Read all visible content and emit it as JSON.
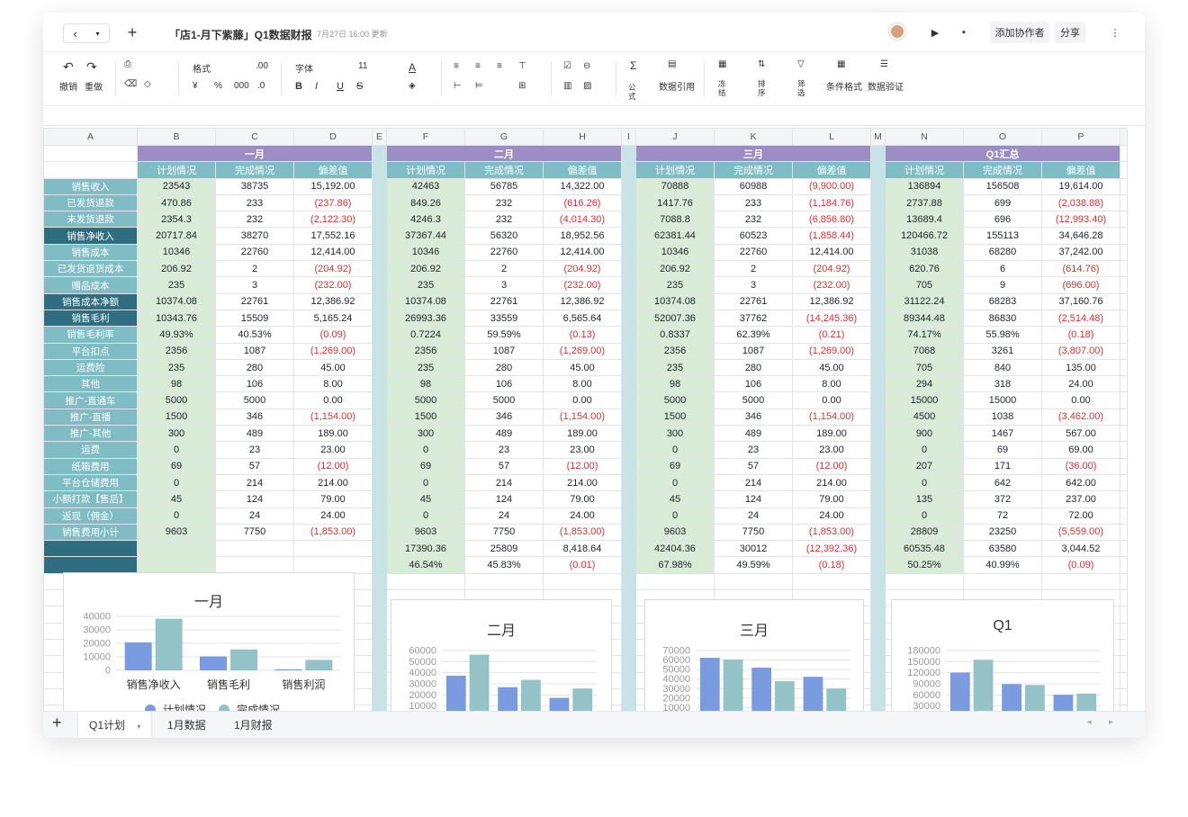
{
  "title": "「店1-月下紫藤」Q1数据财报",
  "updated": "7月27日 16:00 更新",
  "header_buttons": {
    "collab": "添加协作者",
    "share": "分享"
  },
  "ribbon": {
    "undo": "撤销",
    "redo": "重做",
    "format": "格式",
    "decimal": ".00",
    "font": "字体",
    "size": "11",
    "currency": "¥",
    "percent": "%",
    "thousands": "000",
    "decimal2": ".0",
    "formula": "公式",
    "dataref": "数据引用",
    "freeze": "冻结",
    "sort": "排序",
    "filter": "筛选",
    "cond": "条件格式",
    "validate": "数据验证"
  },
  "columns": [
    "A",
    "B",
    "C",
    "D",
    "E",
    "F",
    "G",
    "H",
    "I",
    "J",
    "K",
    "L",
    "M",
    "N",
    "O",
    "P"
  ],
  "months": [
    "一月",
    "二月",
    "三月",
    "Q1汇总"
  ],
  "subheaders": [
    "计划情况",
    "完成情况",
    "偏差值"
  ],
  "rows": [
    {
      "label": "销售收入",
      "dark": false,
      "v": [
        [
          "23543",
          "38735",
          "15,192.00"
        ],
        [
          "42463",
          "56785",
          "14,322.00"
        ],
        [
          "70888",
          "60988",
          "(9,900.00)"
        ],
        [
          "136894",
          "156508",
          "19,614.00"
        ]
      ]
    },
    {
      "label": "已发货退款",
      "dark": false,
      "v": [
        [
          "470.86",
          "233",
          "(237.86)"
        ],
        [
          "849.26",
          "232",
          "(616.26)"
        ],
        [
          "1417.76",
          "233",
          "(1,184.76)"
        ],
        [
          "2737.88",
          "699",
          "(2,038.88)"
        ]
      ]
    },
    {
      "label": "未发货退款",
      "dark": false,
      "v": [
        [
          "2354.3",
          "232",
          "(2,122.30)"
        ],
        [
          "4246.3",
          "232",
          "(4,014.30)"
        ],
        [
          "7088.8",
          "232",
          "(6,856.80)"
        ],
        [
          "13689.4",
          "696",
          "(12,993.40)"
        ]
      ]
    },
    {
      "label": "销售净收入",
      "dark": true,
      "v": [
        [
          "20717.84",
          "38270",
          "17,552.16"
        ],
        [
          "37367.44",
          "56320",
          "18,952.56"
        ],
        [
          "62381.44",
          "60523",
          "(1,858.44)"
        ],
        [
          "120466.72",
          "155113",
          "34,646.28"
        ]
      ]
    },
    {
      "label": "销售成本",
      "dark": false,
      "v": [
        [
          "10346",
          "22760",
          "12,414.00"
        ],
        [
          "10346",
          "22760",
          "12,414.00"
        ],
        [
          "10346",
          "22760",
          "12,414.00"
        ],
        [
          "31038",
          "68280",
          "37,242.00"
        ]
      ]
    },
    {
      "label": "已发货退货成本",
      "dark": false,
      "v": [
        [
          "206.92",
          "2",
          "(204.92)"
        ],
        [
          "206.92",
          "2",
          "(204.92)"
        ],
        [
          "206.92",
          "2",
          "(204.92)"
        ],
        [
          "620.76",
          "6",
          "(614.76)"
        ]
      ]
    },
    {
      "label": "赠品成本",
      "dark": false,
      "v": [
        [
          "235",
          "3",
          "(232.00)"
        ],
        [
          "235",
          "3",
          "(232.00)"
        ],
        [
          "235",
          "3",
          "(232.00)"
        ],
        [
          "705",
          "9",
          "(696.00)"
        ]
      ]
    },
    {
      "label": "销售成本净额",
      "dark": true,
      "v": [
        [
          "10374.08",
          "22761",
          "12,386.92"
        ],
        [
          "10374.08",
          "22761",
          "12,386.92"
        ],
        [
          "10374.08",
          "22761",
          "12,386.92"
        ],
        [
          "31122.24",
          "68283",
          "37,160.76"
        ]
      ]
    },
    {
      "label": "销售毛利",
      "dark": true,
      "v": [
        [
          "10343.76",
          "15509",
          "5,165.24"
        ],
        [
          "26993.36",
          "33559",
          "6,565.64"
        ],
        [
          "52007.36",
          "37762",
          "(14,245.36)"
        ],
        [
          "89344.48",
          "86830",
          "(2,514.48)"
        ]
      ]
    },
    {
      "label": "销售毛利率",
      "dark": false,
      "v": [
        [
          "49.93%",
          "40.53%",
          "(0.09)"
        ],
        [
          "0.7224",
          "59.59%",
          "(0.13)"
        ],
        [
          "0.8337",
          "62.39%",
          "(0.21)"
        ],
        [
          "74.17%",
          "55.98%",
          "(0.18)"
        ]
      ]
    },
    {
      "label": "平台扣点",
      "dark": false,
      "v": [
        [
          "2356",
          "1087",
          "(1,269.00)"
        ],
        [
          "2356",
          "1087",
          "(1,269.00)"
        ],
        [
          "2356",
          "1087",
          "(1,269.00)"
        ],
        [
          "7068",
          "3261",
          "(3,807.00)"
        ]
      ]
    },
    {
      "label": "运费险",
      "dark": false,
      "v": [
        [
          "235",
          "280",
          "45.00"
        ],
        [
          "235",
          "280",
          "45.00"
        ],
        [
          "235",
          "280",
          "45.00"
        ],
        [
          "705",
          "840",
          "135.00"
        ]
      ]
    },
    {
      "label": "其他",
      "dark": false,
      "v": [
        [
          "98",
          "106",
          "8.00"
        ],
        [
          "98",
          "106",
          "8.00"
        ],
        [
          "98",
          "106",
          "8.00"
        ],
        [
          "294",
          "318",
          "24.00"
        ]
      ]
    },
    {
      "label": "推广-直通车",
      "dark": false,
      "v": [
        [
          "5000",
          "5000",
          "0.00"
        ],
        [
          "5000",
          "5000",
          "0.00"
        ],
        [
          "5000",
          "5000",
          "0.00"
        ],
        [
          "15000",
          "15000",
          "0.00"
        ]
      ]
    },
    {
      "label": "推广-直播",
      "dark": false,
      "v": [
        [
          "1500",
          "346",
          "(1,154.00)"
        ],
        [
          "1500",
          "346",
          "(1,154.00)"
        ],
        [
          "1500",
          "346",
          "(1,154.00)"
        ],
        [
          "4500",
          "1038",
          "(3,462.00)"
        ]
      ]
    },
    {
      "label": "推广-其他",
      "dark": false,
      "v": [
        [
          "300",
          "489",
          "189.00"
        ],
        [
          "300",
          "489",
          "189.00"
        ],
        [
          "300",
          "489",
          "189.00"
        ],
        [
          "900",
          "1467",
          "567.00"
        ]
      ]
    },
    {
      "label": "运费",
      "dark": false,
      "v": [
        [
          "0",
          "23",
          "23.00"
        ],
        [
          "0",
          "23",
          "23.00"
        ],
        [
          "0",
          "23",
          "23.00"
        ],
        [
          "0",
          "69",
          "69.00"
        ]
      ]
    },
    {
      "label": "纸箱费用",
      "dark": false,
      "v": [
        [
          "69",
          "57",
          "(12.00)"
        ],
        [
          "69",
          "57",
          "(12.00)"
        ],
        [
          "69",
          "57",
          "(12.00)"
        ],
        [
          "207",
          "171",
          "(36.00)"
        ]
      ]
    },
    {
      "label": "平台仓储费用",
      "dark": false,
      "v": [
        [
          "0",
          "214",
          "214.00"
        ],
        [
          "0",
          "214",
          "214.00"
        ],
        [
          "0",
          "214",
          "214.00"
        ],
        [
          "0",
          "642",
          "642.00"
        ]
      ]
    },
    {
      "label": "小额打款【售后】",
      "dark": false,
      "v": [
        [
          "45",
          "124",
          "79.00"
        ],
        [
          "45",
          "124",
          "79.00"
        ],
        [
          "45",
          "124",
          "79.00"
        ],
        [
          "135",
          "372",
          "237.00"
        ]
      ]
    },
    {
      "label": "返现（佣金）",
      "dark": false,
      "v": [
        [
          "0",
          "24",
          "24.00"
        ],
        [
          "0",
          "24",
          "24.00"
        ],
        [
          "0",
          "24",
          "24.00"
        ],
        [
          "0",
          "72",
          "72.00"
        ]
      ]
    },
    {
      "label": "销售费用小计",
      "dark": false,
      "v": [
        [
          "9603",
          "7750",
          "(1,853.00)"
        ],
        [
          "9603",
          "7750",
          "(1,853.00)"
        ],
        [
          "9603",
          "7750",
          "(1,853.00)"
        ],
        [
          "28809",
          "23250",
          "(5,559.00)"
        ]
      ]
    },
    {
      "label": "",
      "dark": true,
      "v": [
        [
          "",
          "",
          ""
        ],
        [
          "17390.36",
          "25809",
          "8,418.64"
        ],
        [
          "42404.36",
          "30012",
          "(12,392.36)"
        ],
        [
          "60535.48",
          "63580",
          "3,044.52"
        ]
      ]
    },
    {
      "label": "",
      "dark": true,
      "v": [
        [
          "",
          "",
          ""
        ],
        [
          "46.54%",
          "45.83%",
          "(0.01)"
        ],
        [
          "67.98%",
          "49.59%",
          "(0.18)"
        ],
        [
          "50.25%",
          "40.99%",
          "(0.09)"
        ]
      ]
    }
  ],
  "chart_data": [
    {
      "type": "bar",
      "title": "一月",
      "categories": [
        "销售净收入",
        "销售毛利",
        "销售利润"
      ],
      "series": [
        {
          "name": "计划情况",
          "values": [
            20718,
            10344,
            741
          ]
        },
        {
          "name": "完成情况",
          "values": [
            38270,
            15509,
            7759
          ]
        }
      ],
      "ylim": [
        0,
        40000
      ],
      "yticks": [
        "40000",
        "30000",
        "20000",
        "10000",
        "0"
      ],
      "legend": [
        "计划情况",
        "完成情况"
      ]
    },
    {
      "type": "bar",
      "title": "二月",
      "series": [
        {
          "name": "计划情况",
          "values": [
            37367,
            26993,
            17390
          ]
        },
        {
          "name": "完成情况",
          "values": [
            56320,
            33559,
            25809
          ]
        }
      ],
      "ylim": [
        0,
        60000
      ],
      "yticks": [
        "60000",
        "50000",
        "40000",
        "30000",
        "20000",
        "10000"
      ]
    },
    {
      "type": "bar",
      "title": "三月",
      "series": [
        {
          "name": "计划情况",
          "values": [
            62381,
            52007,
            42404
          ]
        },
        {
          "name": "完成情况",
          "values": [
            60523,
            37762,
            30012
          ]
        }
      ],
      "ylim": [
        0,
        70000
      ],
      "yticks": [
        "70000",
        "60000",
        "50000",
        "40000",
        "30000",
        "20000",
        "10000"
      ]
    },
    {
      "type": "bar",
      "title": "Q1",
      "series": [
        {
          "name": "计划情况",
          "values": [
            120467,
            89344,
            60535
          ]
        },
        {
          "name": "完成情况",
          "values": [
            155113,
            86830,
            63580
          ]
        }
      ],
      "ylim": [
        0,
        180000
      ],
      "yticks": [
        "180000",
        "150000",
        "120000",
        "90000",
        "60000",
        "30000"
      ]
    }
  ],
  "colors": {
    "plan": "#7b9be0",
    "done": "#93c3c7",
    "header": "#9b8ec5"
  },
  "tabs": [
    "Q1计划",
    "1月数据",
    "1月财报"
  ]
}
